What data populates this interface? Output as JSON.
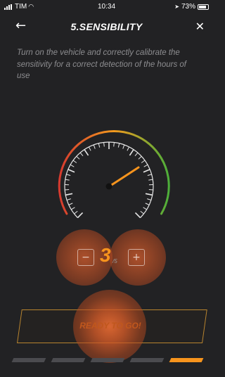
{
  "status_bar": {
    "carrier": "TIM",
    "time": "10:34",
    "battery": "73%"
  },
  "header": {
    "back_icon": "arrow-left-icon",
    "title": "5.SENSIBILITY",
    "close_icon": "close-icon"
  },
  "instructions": "Turn on the vehicle and correctly calibrate the sensitivity for a correct detection of the hours of use",
  "gauge": {
    "arc_colors": [
      "#d63a2f",
      "#f39a1e",
      "#4caf3a"
    ],
    "needle_color": "#f7941d"
  },
  "sensitivity": {
    "value": "3",
    "max": "/5",
    "minus_label": "−",
    "plus_label": "+"
  },
  "ready_button": {
    "label": "READY TO GO!"
  },
  "progress": {
    "current_step": 5,
    "total_steps": 5,
    "active_color": "#f7941d",
    "inactive_color": "#4b4b4f"
  }
}
